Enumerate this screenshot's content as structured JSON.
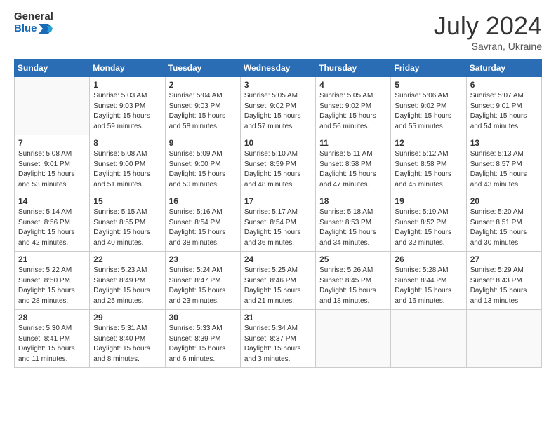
{
  "header": {
    "logo_line1": "General",
    "logo_line2": "Blue",
    "month": "July 2024",
    "location": "Savran, Ukraine"
  },
  "weekdays": [
    "Sunday",
    "Monday",
    "Tuesday",
    "Wednesday",
    "Thursday",
    "Friday",
    "Saturday"
  ],
  "weeks": [
    [
      {
        "day": "",
        "info": ""
      },
      {
        "day": "1",
        "info": "Sunrise: 5:03 AM\nSunset: 9:03 PM\nDaylight: 15 hours\nand 59 minutes."
      },
      {
        "day": "2",
        "info": "Sunrise: 5:04 AM\nSunset: 9:03 PM\nDaylight: 15 hours\nand 58 minutes."
      },
      {
        "day": "3",
        "info": "Sunrise: 5:05 AM\nSunset: 9:02 PM\nDaylight: 15 hours\nand 57 minutes."
      },
      {
        "day": "4",
        "info": "Sunrise: 5:05 AM\nSunset: 9:02 PM\nDaylight: 15 hours\nand 56 minutes."
      },
      {
        "day": "5",
        "info": "Sunrise: 5:06 AM\nSunset: 9:02 PM\nDaylight: 15 hours\nand 55 minutes."
      },
      {
        "day": "6",
        "info": "Sunrise: 5:07 AM\nSunset: 9:01 PM\nDaylight: 15 hours\nand 54 minutes."
      }
    ],
    [
      {
        "day": "7",
        "info": "Sunrise: 5:08 AM\nSunset: 9:01 PM\nDaylight: 15 hours\nand 53 minutes."
      },
      {
        "day": "8",
        "info": "Sunrise: 5:08 AM\nSunset: 9:00 PM\nDaylight: 15 hours\nand 51 minutes."
      },
      {
        "day": "9",
        "info": "Sunrise: 5:09 AM\nSunset: 9:00 PM\nDaylight: 15 hours\nand 50 minutes."
      },
      {
        "day": "10",
        "info": "Sunrise: 5:10 AM\nSunset: 8:59 PM\nDaylight: 15 hours\nand 48 minutes."
      },
      {
        "day": "11",
        "info": "Sunrise: 5:11 AM\nSunset: 8:58 PM\nDaylight: 15 hours\nand 47 minutes."
      },
      {
        "day": "12",
        "info": "Sunrise: 5:12 AM\nSunset: 8:58 PM\nDaylight: 15 hours\nand 45 minutes."
      },
      {
        "day": "13",
        "info": "Sunrise: 5:13 AM\nSunset: 8:57 PM\nDaylight: 15 hours\nand 43 minutes."
      }
    ],
    [
      {
        "day": "14",
        "info": "Sunrise: 5:14 AM\nSunset: 8:56 PM\nDaylight: 15 hours\nand 42 minutes."
      },
      {
        "day": "15",
        "info": "Sunrise: 5:15 AM\nSunset: 8:55 PM\nDaylight: 15 hours\nand 40 minutes."
      },
      {
        "day": "16",
        "info": "Sunrise: 5:16 AM\nSunset: 8:54 PM\nDaylight: 15 hours\nand 38 minutes."
      },
      {
        "day": "17",
        "info": "Sunrise: 5:17 AM\nSunset: 8:54 PM\nDaylight: 15 hours\nand 36 minutes."
      },
      {
        "day": "18",
        "info": "Sunrise: 5:18 AM\nSunset: 8:53 PM\nDaylight: 15 hours\nand 34 minutes."
      },
      {
        "day": "19",
        "info": "Sunrise: 5:19 AM\nSunset: 8:52 PM\nDaylight: 15 hours\nand 32 minutes."
      },
      {
        "day": "20",
        "info": "Sunrise: 5:20 AM\nSunset: 8:51 PM\nDaylight: 15 hours\nand 30 minutes."
      }
    ],
    [
      {
        "day": "21",
        "info": "Sunrise: 5:22 AM\nSunset: 8:50 PM\nDaylight: 15 hours\nand 28 minutes."
      },
      {
        "day": "22",
        "info": "Sunrise: 5:23 AM\nSunset: 8:49 PM\nDaylight: 15 hours\nand 25 minutes."
      },
      {
        "day": "23",
        "info": "Sunrise: 5:24 AM\nSunset: 8:47 PM\nDaylight: 15 hours\nand 23 minutes."
      },
      {
        "day": "24",
        "info": "Sunrise: 5:25 AM\nSunset: 8:46 PM\nDaylight: 15 hours\nand 21 minutes."
      },
      {
        "day": "25",
        "info": "Sunrise: 5:26 AM\nSunset: 8:45 PM\nDaylight: 15 hours\nand 18 minutes."
      },
      {
        "day": "26",
        "info": "Sunrise: 5:28 AM\nSunset: 8:44 PM\nDaylight: 15 hours\nand 16 minutes."
      },
      {
        "day": "27",
        "info": "Sunrise: 5:29 AM\nSunset: 8:43 PM\nDaylight: 15 hours\nand 13 minutes."
      }
    ],
    [
      {
        "day": "28",
        "info": "Sunrise: 5:30 AM\nSunset: 8:41 PM\nDaylight: 15 hours\nand 11 minutes."
      },
      {
        "day": "29",
        "info": "Sunrise: 5:31 AM\nSunset: 8:40 PM\nDaylight: 15 hours\nand 8 minutes."
      },
      {
        "day": "30",
        "info": "Sunrise: 5:33 AM\nSunset: 8:39 PM\nDaylight: 15 hours\nand 6 minutes."
      },
      {
        "day": "31",
        "info": "Sunrise: 5:34 AM\nSunset: 8:37 PM\nDaylight: 15 hours\nand 3 minutes."
      },
      {
        "day": "",
        "info": ""
      },
      {
        "day": "",
        "info": ""
      },
      {
        "day": "",
        "info": ""
      }
    ]
  ]
}
